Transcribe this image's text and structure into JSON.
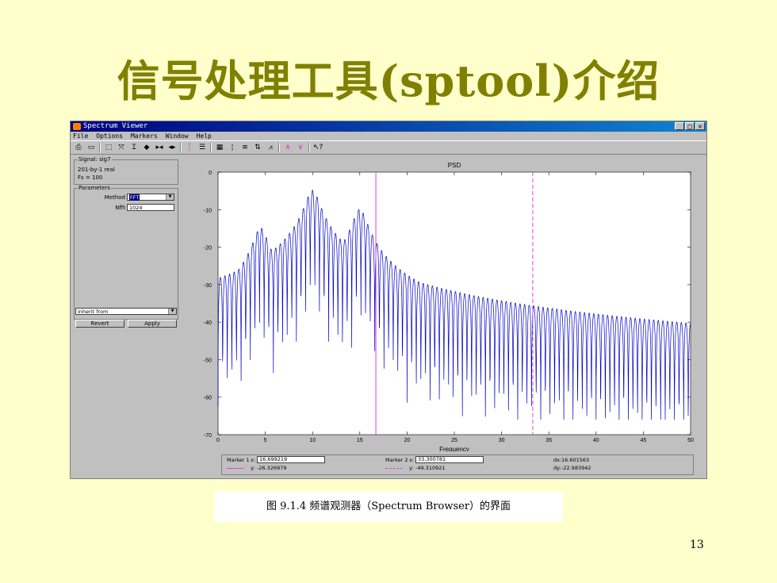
{
  "slide": {
    "title": "信号处理工具(sptool)介绍",
    "caption": "图 9.1.4   频谱观测器（Spectrum Browser）的界面",
    "page_number": "13"
  },
  "window": {
    "title": "Spectrum Viewer",
    "controls": [
      "_",
      "□",
      "×"
    ],
    "menu": [
      "File",
      "Options",
      "Markers",
      "Window",
      "Help"
    ]
  },
  "toolbar": {
    "icons": [
      "print-icon",
      "print-preview-icon",
      "zoom-box-icon",
      "zoom-in-icon",
      "zoom-x-icon",
      "zoom-y-icon",
      "pan-icon",
      "full-view-icon",
      "marker-icon",
      "legend-icon",
      "grid-icon",
      "marker-lines-icon",
      "peaks-icon",
      "valleys-icon",
      "help-pointer-icon"
    ]
  },
  "signal": {
    "group_title": "Signal: sig7",
    "line1": "201-by-1 real",
    "line2": "Fs = 100"
  },
  "parameters": {
    "group_title": "Parameters",
    "method_label": "Method",
    "method_value": "FFT",
    "nfft_label": "Nfft",
    "nfft_value": "1024",
    "inherit_value": "Inherit from",
    "revert_label": "Revert",
    "apply_label": "Apply"
  },
  "markers": {
    "m1_label": "Marker 1",
    "m1_x_label": "x:",
    "m1_x": "16.699219",
    "m1_y_label": "y:",
    "m1_y": "-26.326979",
    "m2_label": "Marker 2",
    "m2_x_label": "x:",
    "m2_x": "33.300781",
    "m2_y_label": "y:",
    "m2_y": "-49.310921",
    "dx_label": "dx:",
    "dx": "16.601563",
    "dy_label": "dy:",
    "dy": "-22.983942"
  },
  "chart_data": {
    "type": "line",
    "title": "PSD",
    "xlabel": "Frequency",
    "ylabel": "",
    "xlim": [
      0,
      50
    ],
    "ylim": [
      -70,
      0
    ],
    "x_ticks": [
      0,
      5,
      10,
      15,
      20,
      25,
      30,
      35,
      40,
      45,
      50
    ],
    "y_ticks": [
      0,
      -10,
      -20,
      -30,
      -40,
      -50,
      -60,
      -70
    ],
    "grid": false,
    "series": [
      {
        "color": "#0000c8",
        "peaks": [
          {
            "x": 10,
            "y": -5
          },
          {
            "x": 15,
            "y": -10
          },
          {
            "x": 4.5,
            "y": -15
          },
          {
            "x": 9.5,
            "y": -15
          }
        ]
      }
    ],
    "marker_lines": [
      {
        "x": 16.699219,
        "style": "solid",
        "color": "#e040e0"
      },
      {
        "x": 33.300781,
        "style": "dashed",
        "color": "#e040e0"
      }
    ]
  }
}
